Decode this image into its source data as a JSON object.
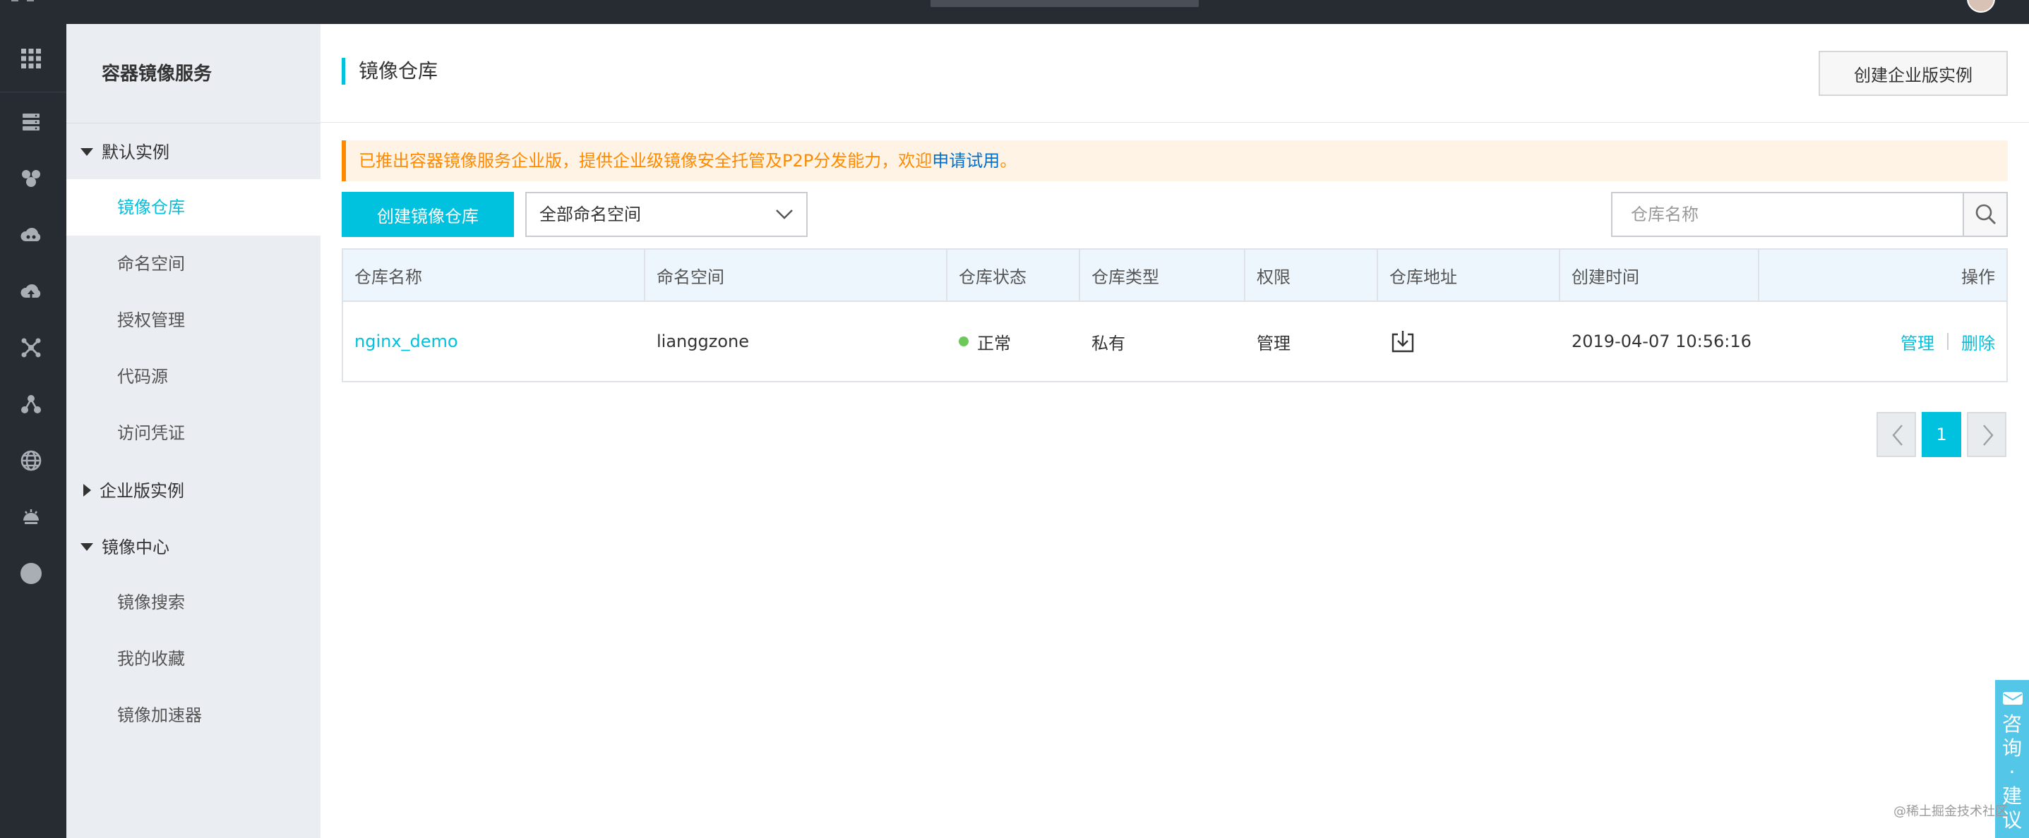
{
  "sidebar": {
    "title": "容器镜像服务",
    "groups": [
      {
        "label": "默认实例",
        "expanded": true,
        "items": [
          "镜像仓库",
          "命名空间",
          "授权管理",
          "代码源",
          "访问凭证"
        ]
      },
      {
        "label": "企业版实例",
        "expanded": false,
        "items": []
      },
      {
        "label": "镜像中心",
        "expanded": true,
        "items": [
          "镜像搜索",
          "我的收藏",
          "镜像加速器"
        ]
      }
    ],
    "active_item": "镜像仓库"
  },
  "rail_icons": [
    "grid-icon",
    "server-icon",
    "cluster-icon",
    "cloud-services-icon",
    "cloud-upload-icon",
    "network-icon",
    "nodes-icon",
    "globe-icon",
    "monitor-icon",
    "circle-icon"
  ],
  "header": {
    "title": "镜像仓库",
    "enterprise_button": "创建企业版实例"
  },
  "notice": {
    "text": "已推出容器镜像服务企业版，提供企业级镜像安全托管及P2P分发能力，欢迎",
    "link": "申请试用",
    "tail": "。"
  },
  "toolbar": {
    "create_button": "创建镜像仓库",
    "namespace_select": "全部命名空间",
    "search_placeholder": "仓库名称"
  },
  "table": {
    "columns": [
      "仓库名称",
      "命名空间",
      "仓库状态",
      "仓库类型",
      "权限",
      "仓库地址",
      "创建时间",
      "操作"
    ],
    "rows": [
      {
        "name": "nginx_demo",
        "namespace": "lianggzone",
        "status": "正常",
        "type": "私有",
        "permission": "管理",
        "address_icon": "download-icon",
        "created": "2019-04-07 10:56:16",
        "actions": [
          "管理",
          "删除"
        ]
      }
    ]
  },
  "pagination": {
    "current": "1"
  },
  "consult": {
    "label": "咨询·建议"
  },
  "watermark": "@稀土掘金技术社区",
  "colors": {
    "accent": "#00c1de",
    "notice": "#ff8a00",
    "status_ok": "#6bc95a",
    "rail_bg": "#272c33"
  }
}
